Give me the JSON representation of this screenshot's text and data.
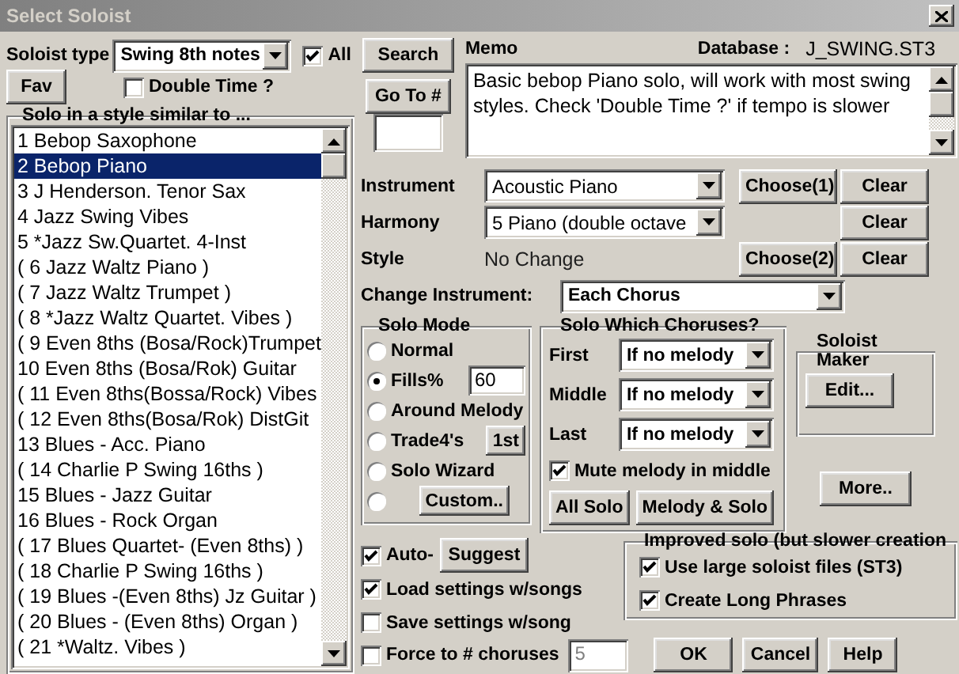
{
  "window": {
    "title": "Select Soloist"
  },
  "soloist_type": {
    "label": "Soloist type",
    "value": "Swing 8th notes"
  },
  "all_checkbox": {
    "label": "All",
    "checked": true
  },
  "fav_button": "Fav",
  "double_time": {
    "label": "Double Time ?",
    "checked": false
  },
  "style_list": {
    "title": "Solo in a style similar to ...",
    "items": [
      {
        "label": "1 Bebop Saxophone",
        "selected": false
      },
      {
        "label": "2 Bebop Piano",
        "selected": true
      },
      {
        "label": "3 J Henderson. Tenor Sax",
        "selected": false
      },
      {
        "label": "4 Jazz Swing Vibes",
        "selected": false
      },
      {
        "label": "5 *Jazz Sw.Quartet. 4-Inst",
        "selected": false
      },
      {
        "label": "( 6 Jazz Waltz Piano )",
        "selected": false
      },
      {
        "label": "( 7 Jazz Waltz Trumpet )",
        "selected": false
      },
      {
        "label": "( 8 *Jazz Waltz Quartet. Vibes )",
        "selected": false
      },
      {
        "label": "( 9 Even 8ths (Bosa/Rock)Trumpet",
        "selected": false
      },
      {
        "label": "10 Even 8ths (Bosa/Rok) Guitar",
        "selected": false
      },
      {
        "label": "( 11 Even 8ths(Bossa/Rock) Vibes",
        "selected": false
      },
      {
        "label": "( 12 Even 8ths(Bosa/Rok) DistGit",
        "selected": false
      },
      {
        "label": "13 Blues - Acc. Piano",
        "selected": false
      },
      {
        "label": "( 14 Charlie P Swing 16ths )",
        "selected": false
      },
      {
        "label": "15 Blues - Jazz Guitar",
        "selected": false
      },
      {
        "label": "16 Blues - Rock Organ",
        "selected": false
      },
      {
        "label": "( 17 Blues Quartet- (Even 8ths)  )",
        "selected": false
      },
      {
        "label": "( 18 Charlie P Swing 16ths )",
        "selected": false
      },
      {
        "label": "( 19 Blues -(Even 8ths) Jz Guitar )",
        "selected": false
      },
      {
        "label": "( 20 Blues - (Even 8ths) Organ )",
        "selected": false
      },
      {
        "label": "( 21 *Waltz. Vibes )",
        "selected": false
      }
    ]
  },
  "search_button": "Search",
  "goto_button": "Go To #",
  "memo": {
    "label": "Memo",
    "text": "Basic bebop Piano solo, will work with most swing styles. Check 'Double Time ?' if tempo is slower"
  },
  "database": {
    "label": "Database :",
    "value": "J_SWING.ST3"
  },
  "instrument": {
    "label": "Instrument",
    "value": "Acoustic Piano",
    "choose_button": "Choose(1)",
    "clear_button": "Clear"
  },
  "harmony": {
    "label": "Harmony",
    "value": "5 Piano (double octave",
    "clear_button": "Clear"
  },
  "style": {
    "label": "Style",
    "value": "No Change",
    "choose_button": "Choose(2)",
    "clear_button": "Clear"
  },
  "change_instrument": {
    "label": "Change Instrument:",
    "value": "Each Chorus"
  },
  "solo_mode": {
    "title": "Solo Mode",
    "options": [
      {
        "label": "Normal",
        "selected": false
      },
      {
        "label": "Fills%",
        "selected": true,
        "field": "60"
      },
      {
        "label": "Around Melody",
        "selected": false
      },
      {
        "label": "Trade4's",
        "selected": false,
        "button": "1st"
      },
      {
        "label": "Solo Wizard",
        "selected": false
      },
      {
        "selected": false,
        "button": "Custom.."
      }
    ]
  },
  "choruses": {
    "title": "Solo Which Choruses?",
    "rows": [
      {
        "label": "First",
        "value": "If no melody"
      },
      {
        "label": "Middle",
        "value": "If no melody"
      },
      {
        "label": "Last",
        "value": "If no melody"
      }
    ],
    "mute_melody": {
      "label": "Mute melody in middle",
      "checked": true
    },
    "buttons": [
      "All Solo",
      "Melody & Solo"
    ]
  },
  "soloist_maker": {
    "title": "Soloist Maker",
    "button": "Edit..."
  },
  "more_button": "More..",
  "auto": {
    "label": "Auto-",
    "checked": true,
    "button": "Suggest"
  },
  "load_settings": {
    "label": "Load settings w/songs",
    "checked": true
  },
  "save_settings": {
    "label": "Save settings w/song",
    "checked": false
  },
  "force_choruses": {
    "label": "Force to # choruses",
    "checked": false,
    "value": "5",
    "disabled": true
  },
  "improved": {
    "title": "Improved solo (but slower creation",
    "options": [
      {
        "label": "Use large soloist files (ST3)",
        "checked": true
      },
      {
        "label": "Create Long Phrases",
        "checked": true
      }
    ]
  },
  "dialog_buttons": [
    "OK",
    "Cancel",
    "Help"
  ]
}
